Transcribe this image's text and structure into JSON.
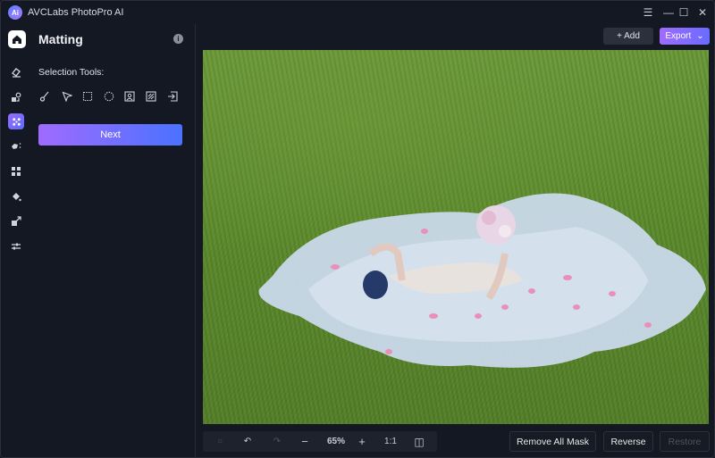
{
  "app": {
    "title": "AVCLabs PhotoPro AI",
    "logo_text": "Ai",
    "window_controls": [
      {
        "name": "menu-icon",
        "glyph": "☰"
      },
      {
        "name": "minimize-icon",
        "glyph": "—"
      },
      {
        "name": "maximize-icon",
        "glyph": "☐"
      },
      {
        "name": "close-icon",
        "glyph": "✕"
      }
    ]
  },
  "rail": {
    "items": [
      {
        "name": "home",
        "icon": "home-icon",
        "active": false
      },
      {
        "name": "eraser",
        "icon": "eraser-icon",
        "active": false
      },
      {
        "name": "replace",
        "icon": "replace-icon",
        "active": false
      },
      {
        "name": "matting",
        "icon": "matting-icon",
        "active": true
      },
      {
        "name": "effects",
        "icon": "sparkle-icon",
        "active": false
      },
      {
        "name": "enhance",
        "icon": "expand-icon",
        "active": false
      },
      {
        "name": "colorize",
        "icon": "paint-bucket-icon",
        "active": false
      },
      {
        "name": "upscale",
        "icon": "upscale-icon",
        "active": false
      },
      {
        "name": "adjust",
        "icon": "sliders-icon",
        "active": false
      }
    ]
  },
  "panel": {
    "title": "Matting",
    "info_glyph": "i",
    "selection_label": "Selection Tools:",
    "tools": [
      {
        "name": "brush",
        "icon": "brush-icon"
      },
      {
        "name": "pointer",
        "icon": "cursor-icon"
      },
      {
        "name": "rect-select",
        "icon": "rect-select-icon"
      },
      {
        "name": "ellipse-select",
        "icon": "ellipse-select-icon"
      },
      {
        "name": "portrait-select",
        "icon": "portrait-icon"
      },
      {
        "name": "background-select",
        "icon": "hatch-icon"
      },
      {
        "name": "import-mask",
        "icon": "import-icon"
      }
    ],
    "next_label": "Next"
  },
  "toolbar": {
    "add_label": "+ Add",
    "export_label": "Export",
    "export_chevron": "⌄"
  },
  "canvas": {
    "image_description": "Bride in white tulle dress lying on green grass with pink petals and bouquet",
    "zoom": "65%",
    "ratio_label": "1:1",
    "controls": [
      {
        "name": "reset",
        "icon": "reset-icon",
        "glyph": "○",
        "enabled": false
      },
      {
        "name": "undo",
        "icon": "undo-icon",
        "glyph": "↶",
        "enabled": true
      },
      {
        "name": "redo",
        "icon": "redo-icon",
        "glyph": "↷",
        "enabled": false
      },
      {
        "name": "zoom-out",
        "icon": "minus-icon",
        "glyph": "−",
        "enabled": true
      },
      {
        "name": "zoom-in",
        "icon": "plus-icon",
        "glyph": "+",
        "enabled": true
      },
      {
        "name": "compare",
        "icon": "compare-icon",
        "glyph": "◫",
        "enabled": true
      }
    ]
  },
  "actions": {
    "remove_all_mask": "Remove All Mask",
    "reverse": "Reverse",
    "restore": "Restore"
  }
}
